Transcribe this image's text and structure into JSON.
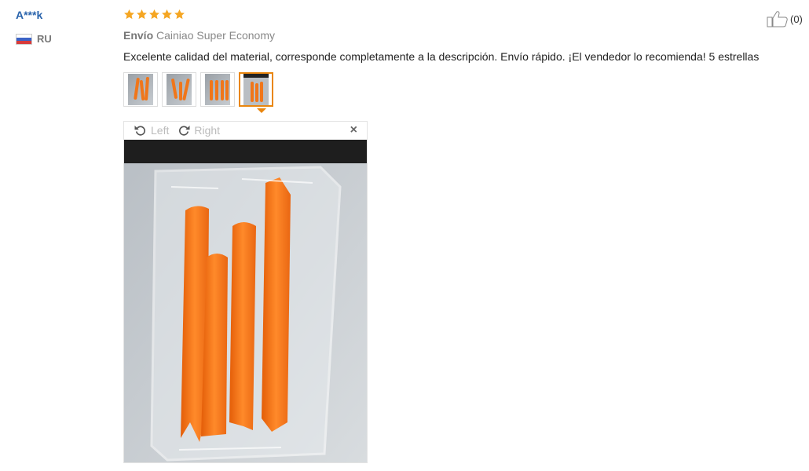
{
  "reviewer": {
    "name": "A***k",
    "country": "RU"
  },
  "rating": {
    "stars": 5,
    "max": 5
  },
  "shipping": {
    "label": "Envío",
    "method": "Cainiao Super Economy"
  },
  "review": {
    "text": "Excelente calidad del material, corresponde completamente a la descripción. Envío rápido. ¡El vendedor lo recomienda! 5 estrellas"
  },
  "helpful": {
    "count": "(0)",
    "icon": "thumbs-up-icon"
  },
  "photos": {
    "count": 4,
    "active_index": 3
  },
  "viewer": {
    "rotate_left": "Left",
    "rotate_right": "Right",
    "close": "×"
  },
  "colors": {
    "accent": "#e9860e",
    "star": "#f5a623",
    "username": "#2a64ac",
    "tool_orange": "#f0761a"
  }
}
